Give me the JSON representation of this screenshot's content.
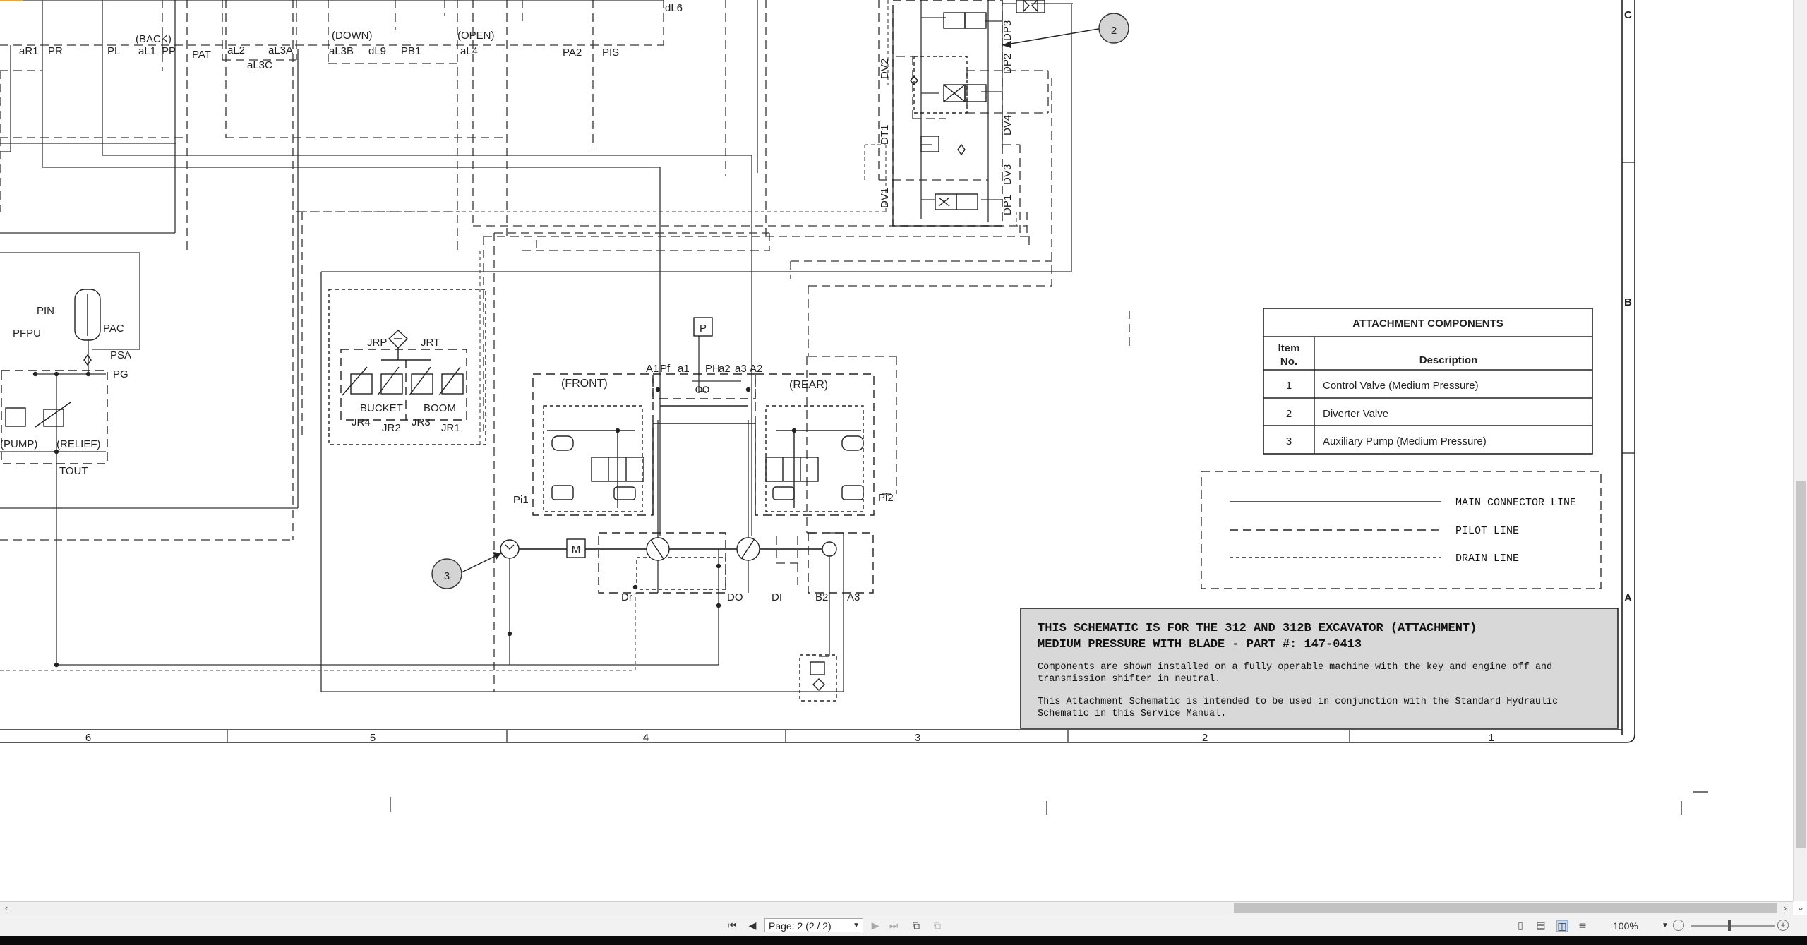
{
  "zone_labels": {
    "rows": [
      "C",
      "B",
      "A"
    ],
    "columns": [
      "6",
      "5",
      "4",
      "3",
      "2",
      "1"
    ]
  },
  "callouts": [
    "2",
    "3"
  ],
  "components_table": {
    "title": "ATTACHMENT COMPONENTS",
    "header_item": [
      "Item",
      "No."
    ],
    "header_desc": "Description",
    "rows": [
      {
        "no": "1",
        "desc": "Control Valve (Medium Pressure)"
      },
      {
        "no": "2",
        "desc": "Diverter Valve"
      },
      {
        "no": "3",
        "desc": "Auxiliary Pump (Medium Pressure)"
      }
    ]
  },
  "legend": {
    "main": "MAIN CONNECTOR LINE",
    "pilot": "PILOT LINE",
    "drain": "DRAIN LINE"
  },
  "title_block": {
    "line1": "THIS SCHEMATIC IS FOR THE 312 AND 312B EXCAVATOR (ATTACHMENT)",
    "line2": "MEDIUM PRESSURE WITH BLADE - PART #: 147-0413",
    "p1_l1": "Components are shown installed on a fully operable machine with the key and engine off and",
    "p1_l2": "transmission shifter in neutral.",
    "p2_l1": "This Attachment Schematic is intended to be used in conjunction with the Standard Hydraulic",
    "p2_l2": "Schematic in this Service Manual."
  },
  "port_labels": {
    "top_row": [
      "aR1",
      "PR",
      "PL",
      "aL1",
      "PP",
      "PAT",
      "aL2",
      "aL3A",
      "aL3C",
      "aL3B",
      "dL9",
      "PB1",
      "aL4",
      "PA2",
      "PIS",
      "dL6"
    ],
    "top_states": [
      "(BACK)",
      "(DOWN)",
      "(OPEN)"
    ],
    "left_block": [
      "PIN",
      "PAC",
      "PFPU",
      "PSA",
      "PG",
      "(PUMP)",
      "(RELIEF)",
      "TOUT"
    ],
    "pilot_block": [
      "JRP",
      "JRT",
      "BUCKET",
      "BOOM",
      "JR4",
      "JR2",
      "JR3",
      "JR1"
    ],
    "control_valve": [
      "(FRONT)",
      "(REAR)",
      "A1",
      "Pf",
      "a1",
      "PH",
      "a2",
      "a3",
      "A2",
      "Pi1",
      "Pi2",
      "Dr",
      "DO",
      "DI",
      "B2",
      "A3",
      "P",
      "M"
    ],
    "diverter": [
      "DV2",
      "DT1",
      "DV1",
      "DP3",
      "DP2",
      "DV4",
      "DV3",
      "DP1"
    ]
  },
  "statusbar": {
    "page_label": "Page: 2 (2 / 2)",
    "zoom": "100%"
  }
}
